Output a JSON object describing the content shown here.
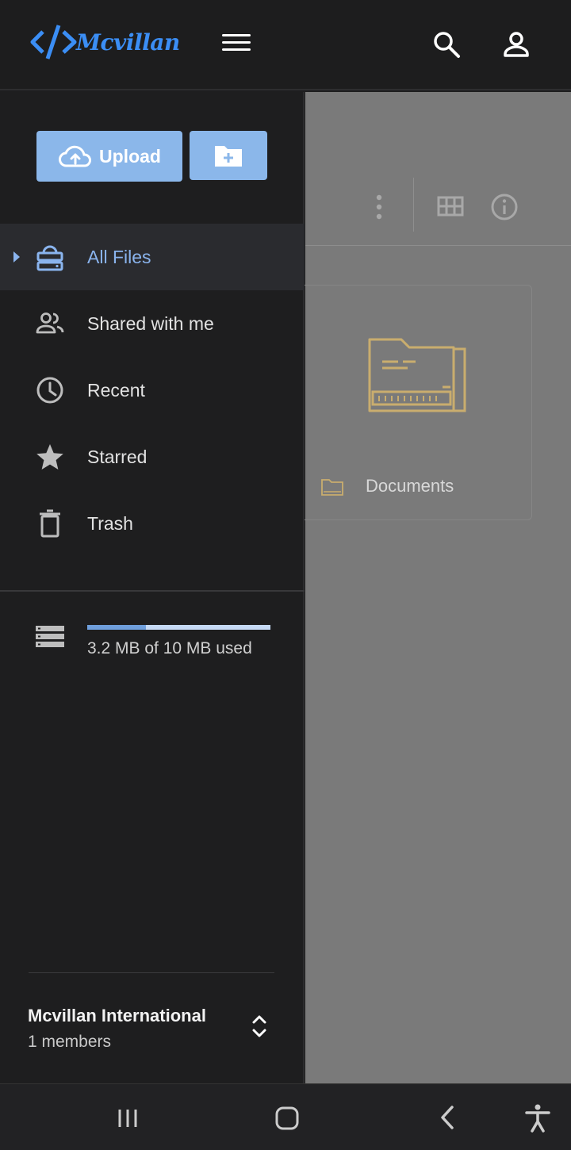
{
  "brand": {
    "name": "Mcvillan",
    "accent": "#3b8ef5"
  },
  "header": {
    "menu_icon": "hamburger-menu-icon",
    "search_icon": "search-icon",
    "account_icon": "account-icon"
  },
  "drawer": {
    "upload_label": "Upload",
    "new_folder_icon": "new-folder-icon",
    "nav": [
      {
        "label": "All Files",
        "icon": "drive-icon",
        "active": true
      },
      {
        "label": "Shared with me",
        "icon": "people-icon",
        "active": false
      },
      {
        "label": "Recent",
        "icon": "clock-icon",
        "active": false
      },
      {
        "label": "Starred",
        "icon": "star-icon",
        "active": false
      },
      {
        "label": "Trash",
        "icon": "trash-icon",
        "active": false
      }
    ],
    "storage": {
      "text": "3.2 MB of 10 MB used",
      "used_fraction": 0.32
    },
    "team": {
      "name": "Mcvillan International",
      "members": "1 members"
    }
  },
  "main": {
    "toolbar_icons": [
      "more-vert-icon",
      "grid-view-icon",
      "info-icon"
    ],
    "folders": [
      {
        "name": "Documents",
        "color": "#e3c17a"
      }
    ]
  },
  "system_nav": [
    "recents-icon",
    "home-icon",
    "back-icon",
    "accessibility-icon"
  ],
  "colors": {
    "drawer_bg": "#1e1e1f",
    "button_bg": "#8bb7ea",
    "active_text": "#8ab4ee",
    "overlay_bg": "#7a7a7a"
  }
}
